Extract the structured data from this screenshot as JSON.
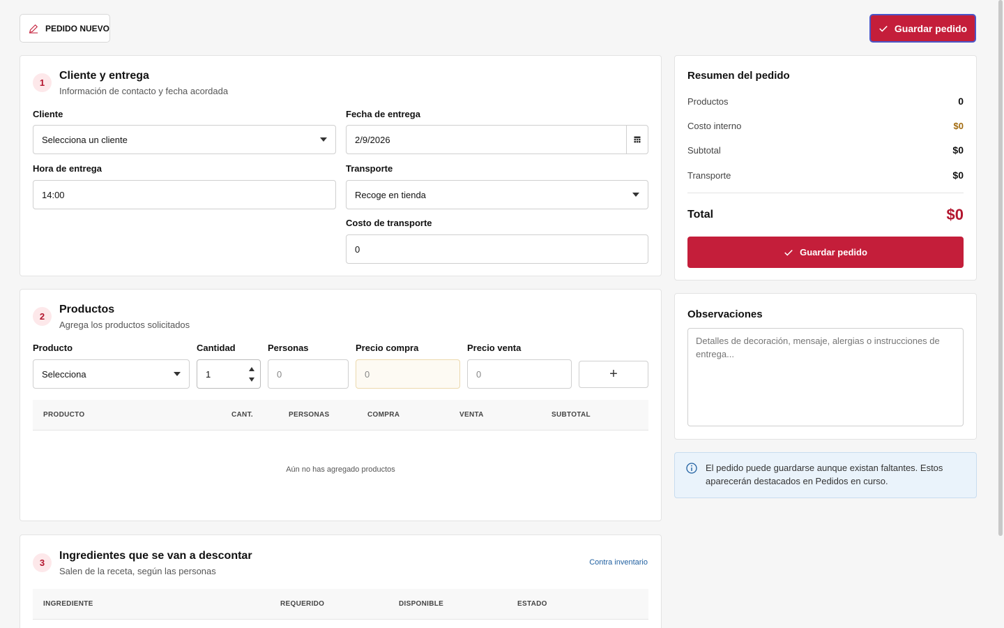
{
  "header": {
    "badge_label": "PEDIDO NUEVO",
    "save_label": "Guardar pedido"
  },
  "colors": {
    "accent": "#c41e3a",
    "focus_ring": "#4b55c8",
    "info_bg": "#eaf3fb"
  },
  "client_section": {
    "step": "1",
    "title": "Cliente y entrega",
    "subtitle": "Información de contacto y fecha acordada",
    "client_label": "Cliente",
    "client_value": "Selecciona un cliente",
    "date_label": "Fecha de entrega",
    "date_value": "2/9/2026",
    "time_label": "Hora de entrega",
    "time_value": "14:00",
    "transport_label": "Transporte",
    "transport_value": "Recoge en tienda",
    "transport_cost_label": "Costo de transporte",
    "transport_cost_value": "0"
  },
  "products_section": {
    "step": "2",
    "title": "Productos",
    "subtitle": "Agrega los productos solicitados",
    "product_label": "Producto",
    "product_value": "Selecciona",
    "qty_label": "Cantidad",
    "qty_value": "1",
    "people_label": "Personas",
    "people_placeholder": "0",
    "buy_price_label": "Precio compra",
    "buy_price_placeholder": "0",
    "sell_price_label": "Precio venta",
    "sell_price_placeholder": "0",
    "add_label": "+",
    "columns": [
      "PRODUCTO",
      "CANT.",
      "PERSONAS",
      "COMPRA",
      "VENTA",
      "SUBTOTAL"
    ],
    "empty_text": "Aún no has agregado productos"
  },
  "ingredients_section": {
    "step": "3",
    "title": "Ingredientes que se van a descontar",
    "subtitle": "Salen de la receta, según las personas",
    "link": "Contra inventario",
    "columns": [
      "INGREDIENTE",
      "REQUERIDO",
      "DISPONIBLE",
      "ESTADO"
    ]
  },
  "summary": {
    "title": "Resumen del pedido",
    "rows": [
      {
        "label": "Productos",
        "value": "0"
      },
      {
        "label": "Costo interno",
        "value": "$0"
      },
      {
        "label": "Subtotal",
        "value": "$0"
      },
      {
        "label": "Transporte",
        "value": "$0"
      }
    ],
    "total_label": "Total",
    "total_value": "$0",
    "save_label": "Guardar pedido"
  },
  "notes": {
    "title": "Observaciones",
    "placeholder": "Detalles de decoración, mensaje, alergias o instrucciones de entrega..."
  },
  "info": {
    "text": "El pedido puede guardarse aunque existan faltantes. Estos aparecerán destacados en Pedidos en curso."
  }
}
